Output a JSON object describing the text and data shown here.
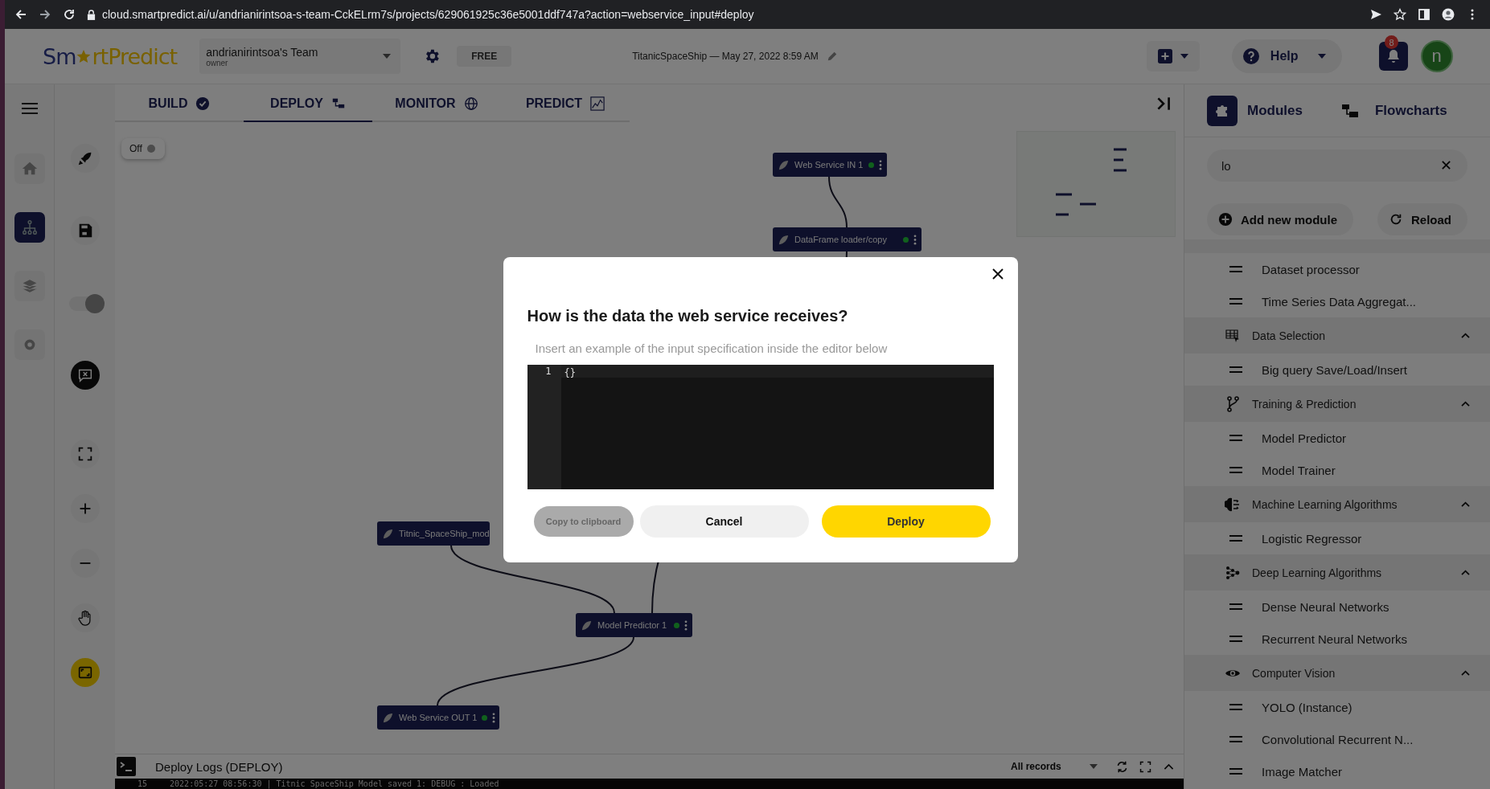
{
  "browser": {
    "url": "cloud.smartpredict.ai/u/andrianirintsoa-s-team-CckELrm7s/projects/629061925c36e5001ddf747a?action=webservice_input#deploy"
  },
  "header": {
    "logo_start": "Sm",
    "logo_end": "rtPredict",
    "team": "andrianirintsoa's Team",
    "role": "owner",
    "plan": "FREE",
    "project": "TitanicSpaceShip — May 27, 2022 8:59 AM",
    "help": "Help",
    "notifications": "8",
    "avatar": "n"
  },
  "side_nav": [
    {
      "selected": false
    },
    {
      "selected": true
    },
    {
      "selected": false
    },
    {
      "selected": false
    }
  ],
  "tabs": [
    {
      "label": "BUILD",
      "selected": false
    },
    {
      "label": "DEPLOY",
      "selected": true
    },
    {
      "label": "MONITOR",
      "selected": false
    },
    {
      "label": "PREDICT",
      "selected": false
    }
  ],
  "canvas": {
    "deploy_switch": {
      "label": "Off",
      "on": false
    },
    "nodes": [
      {
        "label": "Web Service IN 1",
        "active": true
      },
      {
        "label": "DataFrame loader/copy",
        "active": true
      },
      {
        "label": "Titnic_SpaceShip_mod",
        "active": false
      },
      {
        "label": "Model Predictor 1",
        "active": true
      },
      {
        "label": "Web Service OUT 1",
        "active": true
      }
    ]
  },
  "logs": {
    "title": "Deploy Logs (DEPLOY)",
    "filter": "All records",
    "line_number": "15",
    "line": "2022:05:27 08:56:30 | Titnic SpaceShip Model saved 1: DEBUG : Loaded"
  },
  "panel": {
    "tabs": [
      {
        "label": "Modules",
        "selected": true
      },
      {
        "label": "Flowcharts",
        "selected": false
      }
    ],
    "search": {
      "value": "lo"
    },
    "add_button": "Add new module",
    "reload_button": "Reload",
    "groups": [
      {
        "items": [
          "Dataset processor",
          "Time Series Data Aggregat..."
        ]
      },
      {
        "title": "Data Selection",
        "expanded": true,
        "items": [
          "Big query Save/Load/Insert"
        ]
      },
      {
        "title": "Training & Prediction",
        "expanded": true,
        "items": [
          "Model Predictor",
          "Model Trainer"
        ]
      },
      {
        "title": "Machine Learning Algorithms",
        "expanded": true,
        "items": [
          "Logistic Regressor"
        ]
      },
      {
        "title": "Deep Learning Algorithms",
        "expanded": true,
        "items": [
          "Dense Neural Networks",
          "Recurrent Neural Networks"
        ]
      },
      {
        "title": "Computer Vision",
        "expanded": true,
        "items": [
          "YOLO (Instance)",
          "Convolutional Recurrent N...",
          "Image Matcher"
        ]
      }
    ]
  },
  "dialog": {
    "title": "How is the data the web service receives?",
    "hint": "Insert an example of the input specification inside the editor below",
    "editor": {
      "line_number": "1",
      "code": "{}"
    },
    "copy_button": "Copy to clipboard",
    "cancel_button": "Cancel",
    "deploy_button": "Deploy"
  }
}
